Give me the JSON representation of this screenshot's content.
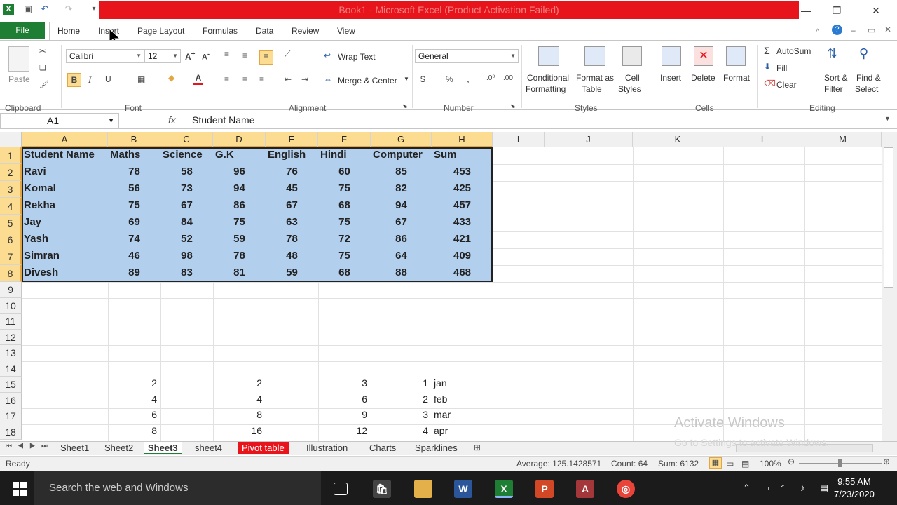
{
  "window": {
    "title": "Book1 - Microsoft Excel (Product Activation Failed)"
  },
  "tabs": [
    "Insert",
    "Page Layout",
    "Formulas",
    "Data",
    "Review",
    "View"
  ],
  "file_tab": "File",
  "home_tab": "Home",
  "ribbon": {
    "clipboard": {
      "label": "Clipboard",
      "paste": "Paste"
    },
    "font": {
      "label": "Font",
      "name": "Calibri",
      "size": "12",
      "bold": "B",
      "italic": "I",
      "underline": "U"
    },
    "alignment": {
      "label": "Alignment",
      "wrap": "Wrap Text",
      "merge": "Merge & Center"
    },
    "number": {
      "label": "Number",
      "format": "General",
      "currency": "$",
      "percent": "%",
      "comma": ","
    },
    "styles": {
      "label": "Styles",
      "conditional": "Conditional",
      "conditional2": "Formatting",
      "format_table": "Format as",
      "format_table2": "Table",
      "cell_styles": "Cell",
      "cell_styles2": "Styles"
    },
    "cells": {
      "label": "Cells",
      "insert": "Insert",
      "delete": "Delete",
      "format": "Format"
    },
    "editing": {
      "label": "Editing",
      "autosum": "AutoSum",
      "fill": "Fill",
      "clear": "Clear",
      "sort": "Sort &",
      "sort2": "Filter",
      "find": "Find &",
      "find2": "Select"
    }
  },
  "formula_bar": {
    "name_box": "A1",
    "fx": "fx",
    "value": "Student Name"
  },
  "columns": [
    "A",
    "B",
    "C",
    "D",
    "E",
    "F",
    "G",
    "H",
    "I",
    "J",
    "K",
    "L",
    "M"
  ],
  "rows": [
    "1",
    "2",
    "3",
    "4",
    "5",
    "6",
    "7",
    "8",
    "9",
    "10",
    "11",
    "12",
    "13",
    "14",
    "15",
    "16",
    "17",
    "18"
  ],
  "table": {
    "headers": [
      "Student Name",
      "Maths",
      "Science",
      "G.K",
      "English",
      "Hindi",
      "Computer",
      "Sum"
    ],
    "rows": [
      [
        "Ravi",
        "78",
        "58",
        "96",
        "76",
        "60",
        "85",
        "453"
      ],
      [
        "Komal",
        "56",
        "73",
        "94",
        "45",
        "75",
        "82",
        "425"
      ],
      [
        "Rekha",
        "75",
        "67",
        "86",
        "67",
        "68",
        "94",
        "457"
      ],
      [
        "Jay",
        "69",
        "84",
        "75",
        "63",
        "75",
        "67",
        "433"
      ],
      [
        "Yash",
        "74",
        "52",
        "59",
        "78",
        "72",
        "86",
        "421"
      ],
      [
        "Simran",
        "46",
        "98",
        "78",
        "48",
        "75",
        "64",
        "409"
      ],
      [
        "Divesh",
        "89",
        "83",
        "81",
        "59",
        "68",
        "88",
        "468"
      ]
    ]
  },
  "lower": [
    [
      "2",
      "2",
      "3",
      "1",
      "jan"
    ],
    [
      "4",
      "4",
      "6",
      "2",
      "feb"
    ],
    [
      "6",
      "8",
      "9",
      "3",
      "mar"
    ],
    [
      "8",
      "16",
      "12",
      "4",
      "apr"
    ]
  ],
  "sheets": [
    "Sheet1",
    "Sheet2",
    "Sheet3",
    "sheet4",
    "Pivot table",
    "Illustration",
    "Charts",
    "Sparklines"
  ],
  "status": {
    "ready": "Ready",
    "average": "Average: 125.1428571",
    "count": "Count: 64",
    "sum": "Sum: 6132",
    "zoom": "100%"
  },
  "watermark": {
    "line1": "Activate Windows",
    "line2": "Go to Settings to activate Windows."
  },
  "taskbar": {
    "search": "Search the web and Windows",
    "time": "9:55 AM",
    "date": "7/23/2020"
  }
}
